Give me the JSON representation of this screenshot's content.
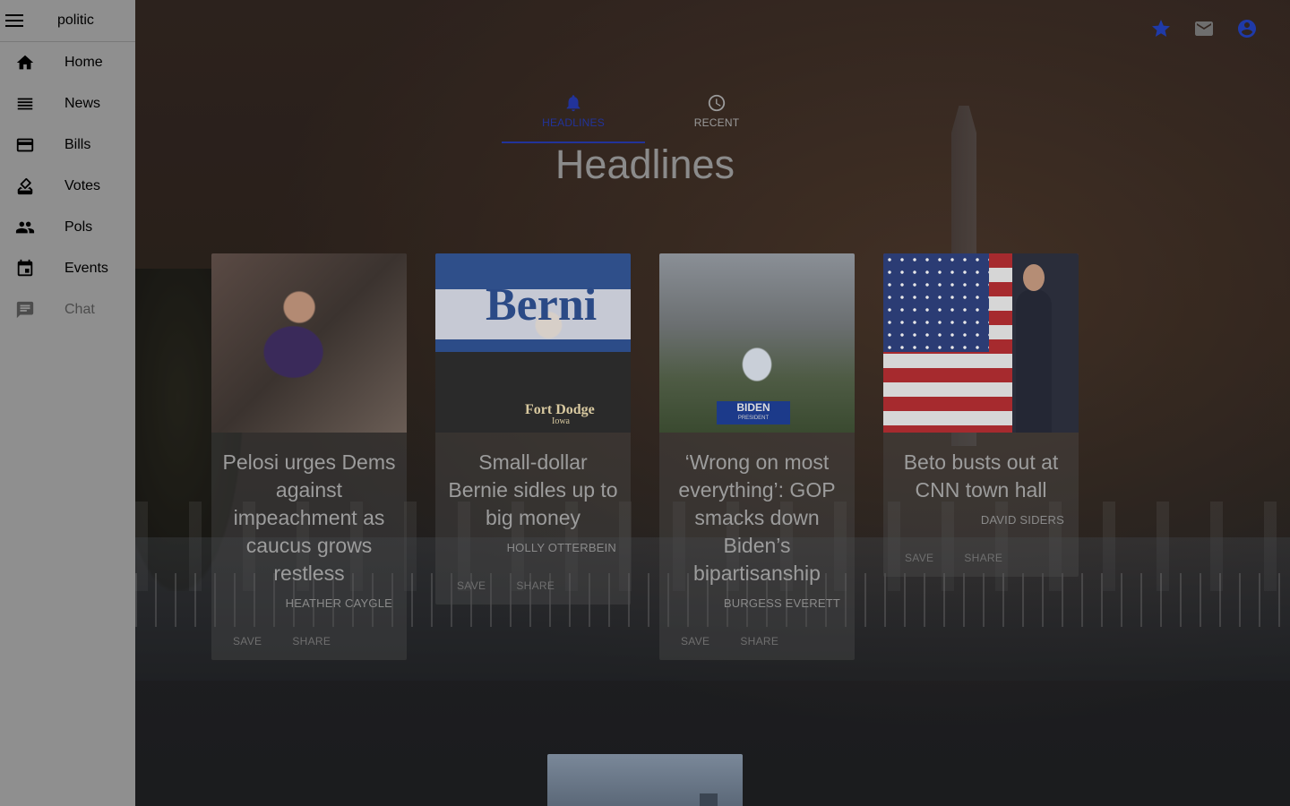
{
  "app": {
    "title": "politic"
  },
  "sidebar": {
    "items": [
      {
        "label": "Home",
        "icon": "home-icon"
      },
      {
        "label": "News",
        "icon": "news-icon"
      },
      {
        "label": "Bills",
        "icon": "bills-icon"
      },
      {
        "label": "Votes",
        "icon": "votes-icon"
      },
      {
        "label": "Pols",
        "icon": "pols-icon"
      },
      {
        "label": "Events",
        "icon": "events-icon"
      },
      {
        "label": "Chat",
        "icon": "chat-icon",
        "disabled": true
      }
    ]
  },
  "top_icons": [
    "star-icon",
    "mail-icon",
    "account-icon"
  ],
  "colors": {
    "accent": "#22339a",
    "sidebar_bg": "#8f8f8f",
    "text_muted": "#9c9c9c"
  },
  "tabs": [
    {
      "label": "HEADLINES",
      "icon": "bell-icon",
      "active": true
    },
    {
      "label": "RECENT",
      "icon": "clock-icon",
      "active": false
    }
  ],
  "main": {
    "heading": "Headlines"
  },
  "cards": [
    {
      "title": "Pelosi urges Dems against impeachment as caucus grows restless",
      "author": "HEATHER CAYGLE",
      "save": "SAVE",
      "share": "SHARE"
    },
    {
      "title": "Small-dollar Bernie sidles up to big money",
      "author": "HOLLY OTTERBEIN",
      "save": "SAVE",
      "share": "SHARE"
    },
    {
      "title": "‘Wrong on most everything’: GOP smacks down Biden’s bipartisanship",
      "author": "BURGESS EVERETT",
      "save": "SAVE",
      "share": "SHARE"
    },
    {
      "title": "Beto busts out at CNN town hall",
      "author": "DAVID SIDERS",
      "save": "SAVE",
      "share": "SHARE"
    }
  ],
  "photo_text": {
    "sign_left": "Berni",
    "sign_bottom": "Fort Dodge",
    "sign_bottom2": "Iowa",
    "podium": "BIDEN",
    "podium_sub": "PRESIDENT"
  }
}
